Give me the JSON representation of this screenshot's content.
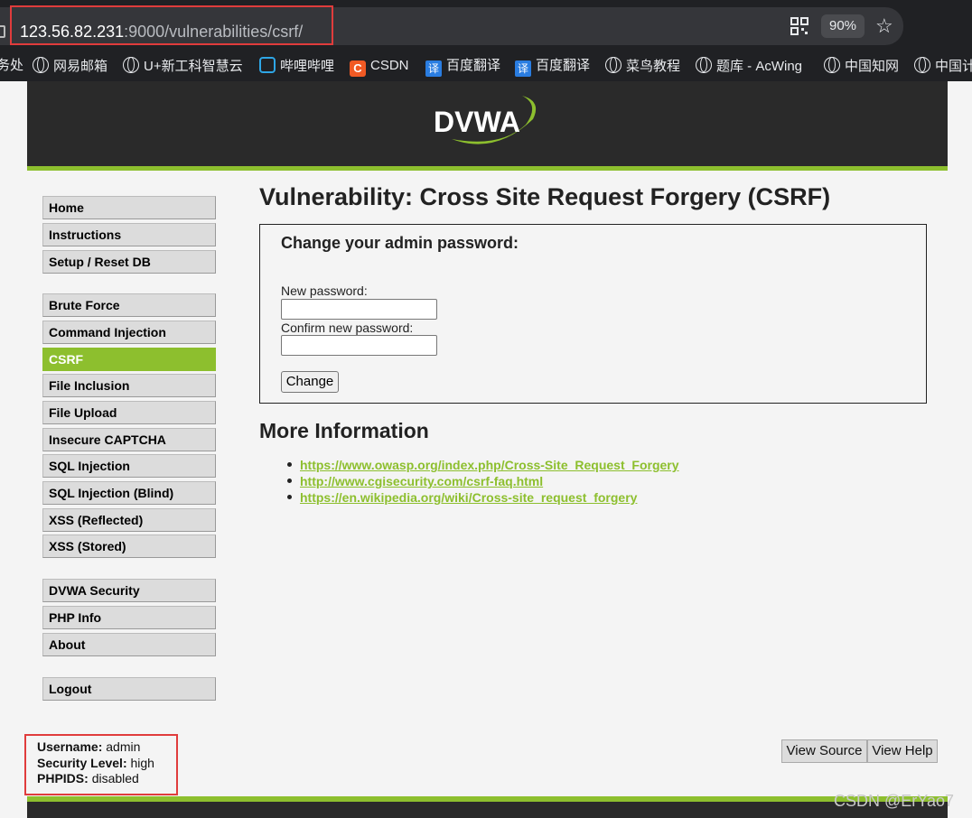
{
  "browser": {
    "url_host": "123.56.82.231",
    "url_path": ":9000/vulnerabilities/csrf/",
    "zoom": "90%",
    "bookmarks": [
      {
        "label": "务处",
        "icon": "none"
      },
      {
        "label": "网易邮箱",
        "icon": "globe-icon"
      },
      {
        "label": "U+新工科智慧云",
        "icon": "globe-icon"
      },
      {
        "label": "哔哩哔哩",
        "icon": "bilibili-icon"
      },
      {
        "label": "CSDN",
        "icon": "csdn-icon"
      },
      {
        "label": "百度翻译",
        "icon": "translate-icon"
      },
      {
        "label": "百度翻译",
        "icon": "translate-icon"
      },
      {
        "label": "菜鸟教程",
        "icon": "globe-icon"
      },
      {
        "label": "题库 - AcWing",
        "icon": "globe-icon"
      },
      {
        "label": "中国知网",
        "icon": "globe-icon"
      },
      {
        "label": "中国计",
        "icon": "globe-icon"
      }
    ]
  },
  "header": {
    "logo": "DVWA"
  },
  "menu": {
    "group1": [
      "Home",
      "Instructions",
      "Setup / Reset DB"
    ],
    "group2": [
      "Brute Force",
      "Command Injection",
      "CSRF",
      "File Inclusion",
      "File Upload",
      "Insecure CAPTCHA",
      "SQL Injection",
      "SQL Injection (Blind)",
      "XSS (Reflected)",
      "XSS (Stored)"
    ],
    "group3": [
      "DVWA Security",
      "PHP Info",
      "About"
    ],
    "group4": [
      "Logout"
    ],
    "active": "CSRF"
  },
  "main": {
    "title": "Vulnerability: Cross Site Request Forgery (CSRF)",
    "form": {
      "heading": "Change your admin password:",
      "new_password_label": "New password:",
      "confirm_password_label": "Confirm new password:",
      "new_password_value": "",
      "confirm_password_value": "",
      "button": "Change"
    },
    "more_info_heading": "More Information",
    "links": [
      "https://www.owasp.org/index.php/Cross-Site_Request_Forgery",
      "http://www.cgisecurity.com/csrf-faq.html",
      "https://en.wikipedia.org/wiki/Cross-site_request_forgery"
    ]
  },
  "status": {
    "username_label": "Username:",
    "username": "admin",
    "security_label": "Security Level:",
    "security": "high",
    "phpids_label": "PHPIDS:",
    "phpids": "disabled"
  },
  "footer": {
    "view_source": "View Source",
    "view_help": "View Help"
  },
  "watermark": "CSDN @ErYao7",
  "colors": {
    "accent": "#8dbf2e",
    "header": "#2a2a2a",
    "highlight": "#e03c3c"
  }
}
